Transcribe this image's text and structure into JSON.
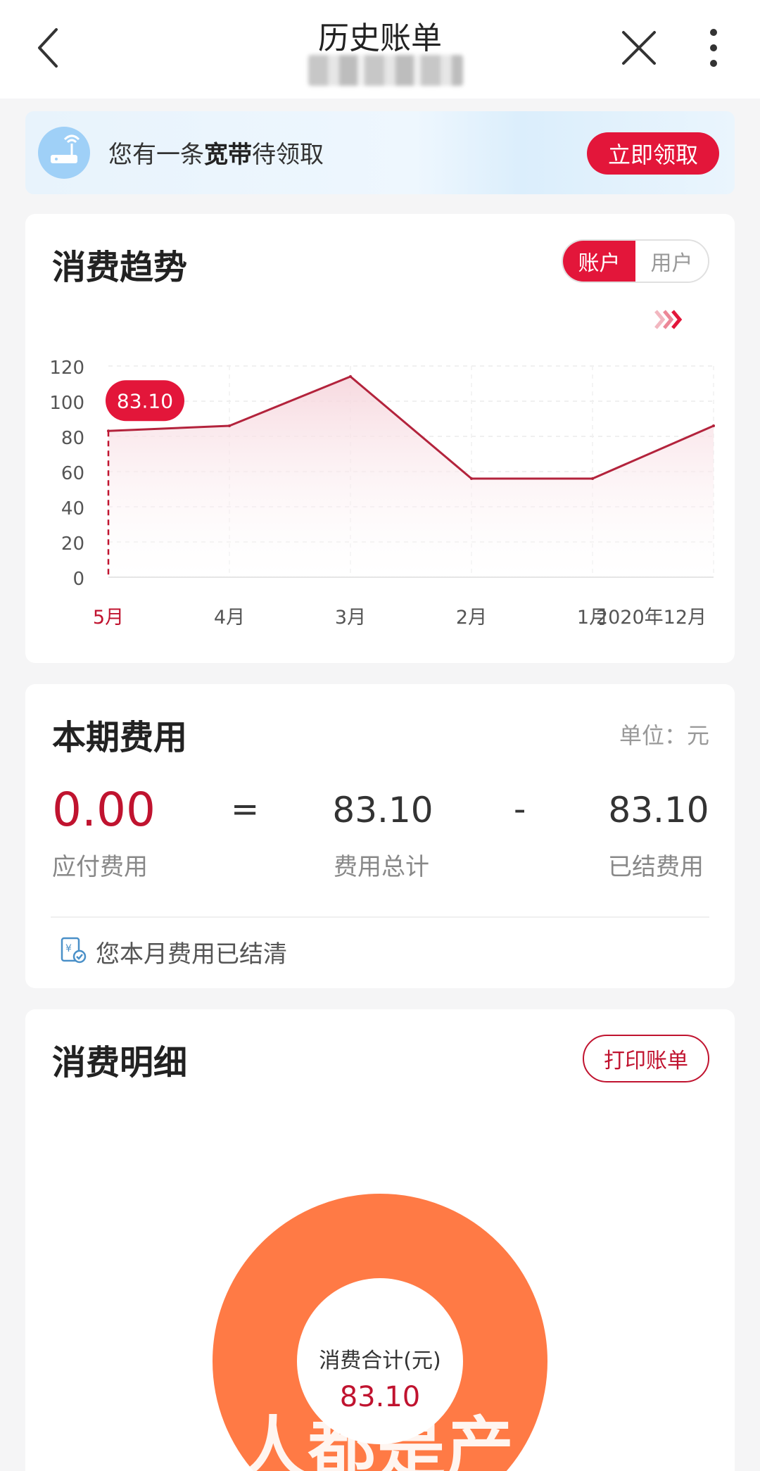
{
  "header": {
    "title": "历史账单"
  },
  "banner": {
    "text_prefix": "您有一条",
    "text_bold": "宽带",
    "text_suffix": "待领取",
    "button": "立即领取"
  },
  "trend": {
    "title": "消费趋势",
    "toggle": [
      "账户",
      "用户"
    ],
    "tooltip": "83.10"
  },
  "chart_data": {
    "type": "line",
    "categories": [
      "5月",
      "4月",
      "3月",
      "2月",
      "1月",
      "2020年12月"
    ],
    "values": [
      83.1,
      86,
      114,
      56,
      56,
      86
    ],
    "ylim": [
      0,
      120
    ],
    "yticks": [
      "120",
      "100",
      "80",
      "60",
      "40",
      "20",
      "0"
    ],
    "grid": true,
    "colors": {
      "line": "#b3233c",
      "selected_label": "#c0132f"
    }
  },
  "cost": {
    "title": "本期费用",
    "unit": "单位：元",
    "payable_value": "0.00",
    "payable_label": "应付费用",
    "equals": "=",
    "total_value": "83.10",
    "total_label": "费用总计",
    "minus": "-",
    "settled_value": "83.10",
    "settled_label": "已结费用",
    "status": "您本月费用已结清"
  },
  "detail": {
    "title": "消费明细",
    "print_button": "打印账单",
    "donut_label": "消费合计(元)",
    "donut_value": "83.10",
    "donut_color": "#ff7a45"
  },
  "watermark": "人都是产"
}
